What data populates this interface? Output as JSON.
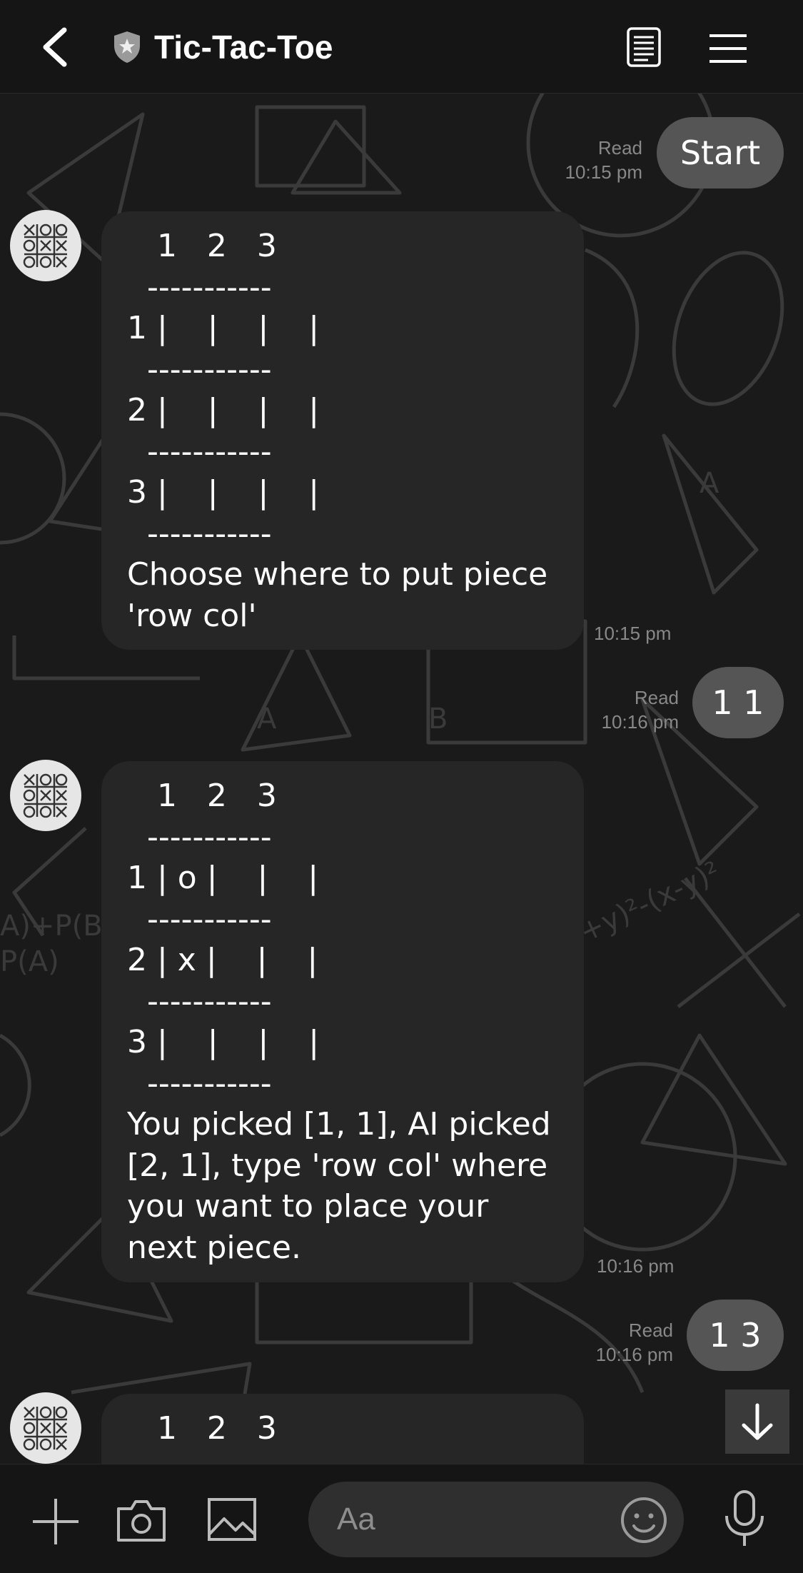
{
  "header": {
    "title": "Tic-Tac-Toe",
    "back_icon": "chevron-left-icon",
    "shield_icon": "shield-star-icon",
    "notes_icon": "notes-icon",
    "menu_icon": "hamburger-menu-icon"
  },
  "messages": [
    {
      "type": "out",
      "text": "Start",
      "status": "Read",
      "time": "10:15 pm"
    },
    {
      "type": "in",
      "grid": "   1   2   3\n  -----------\n1 |    |    |    |\n  -----------\n2 |    |    |    |\n  -----------\n3 |    |    |    |\n  -----------",
      "text": "Choose where to put piece 'row col'",
      "time": "10:15 pm"
    },
    {
      "type": "out",
      "text": "1 1",
      "status": "Read",
      "time": "10:16 pm"
    },
    {
      "type": "in",
      "grid": "   1   2   3\n  -----------\n1 | o |    |    |\n  -----------\n2 | x |    |    |\n  -----------\n3 |    |    |    |\n  -----------",
      "text": "You picked [1, 1], AI picked [2, 1], type 'row col' where you want to place your next piece.",
      "time": "10:16 pm"
    },
    {
      "type": "out",
      "text": "1 3",
      "status": "Read",
      "time": "10:16 pm"
    },
    {
      "type": "in",
      "grid": "   1   2   3"
    }
  ],
  "footer": {
    "input_placeholder": "Aa",
    "add_icon": "plus-icon",
    "camera_icon": "camera-icon",
    "image_icon": "image-icon",
    "emoji_icon": "emoji-icon",
    "mic_icon": "microphone-icon"
  },
  "scroll_down_icon": "arrow-down-icon",
  "colors": {
    "background": "#161616",
    "bubble_in": "#262626",
    "bubble_out": "#555555",
    "meta_text": "#888888"
  }
}
